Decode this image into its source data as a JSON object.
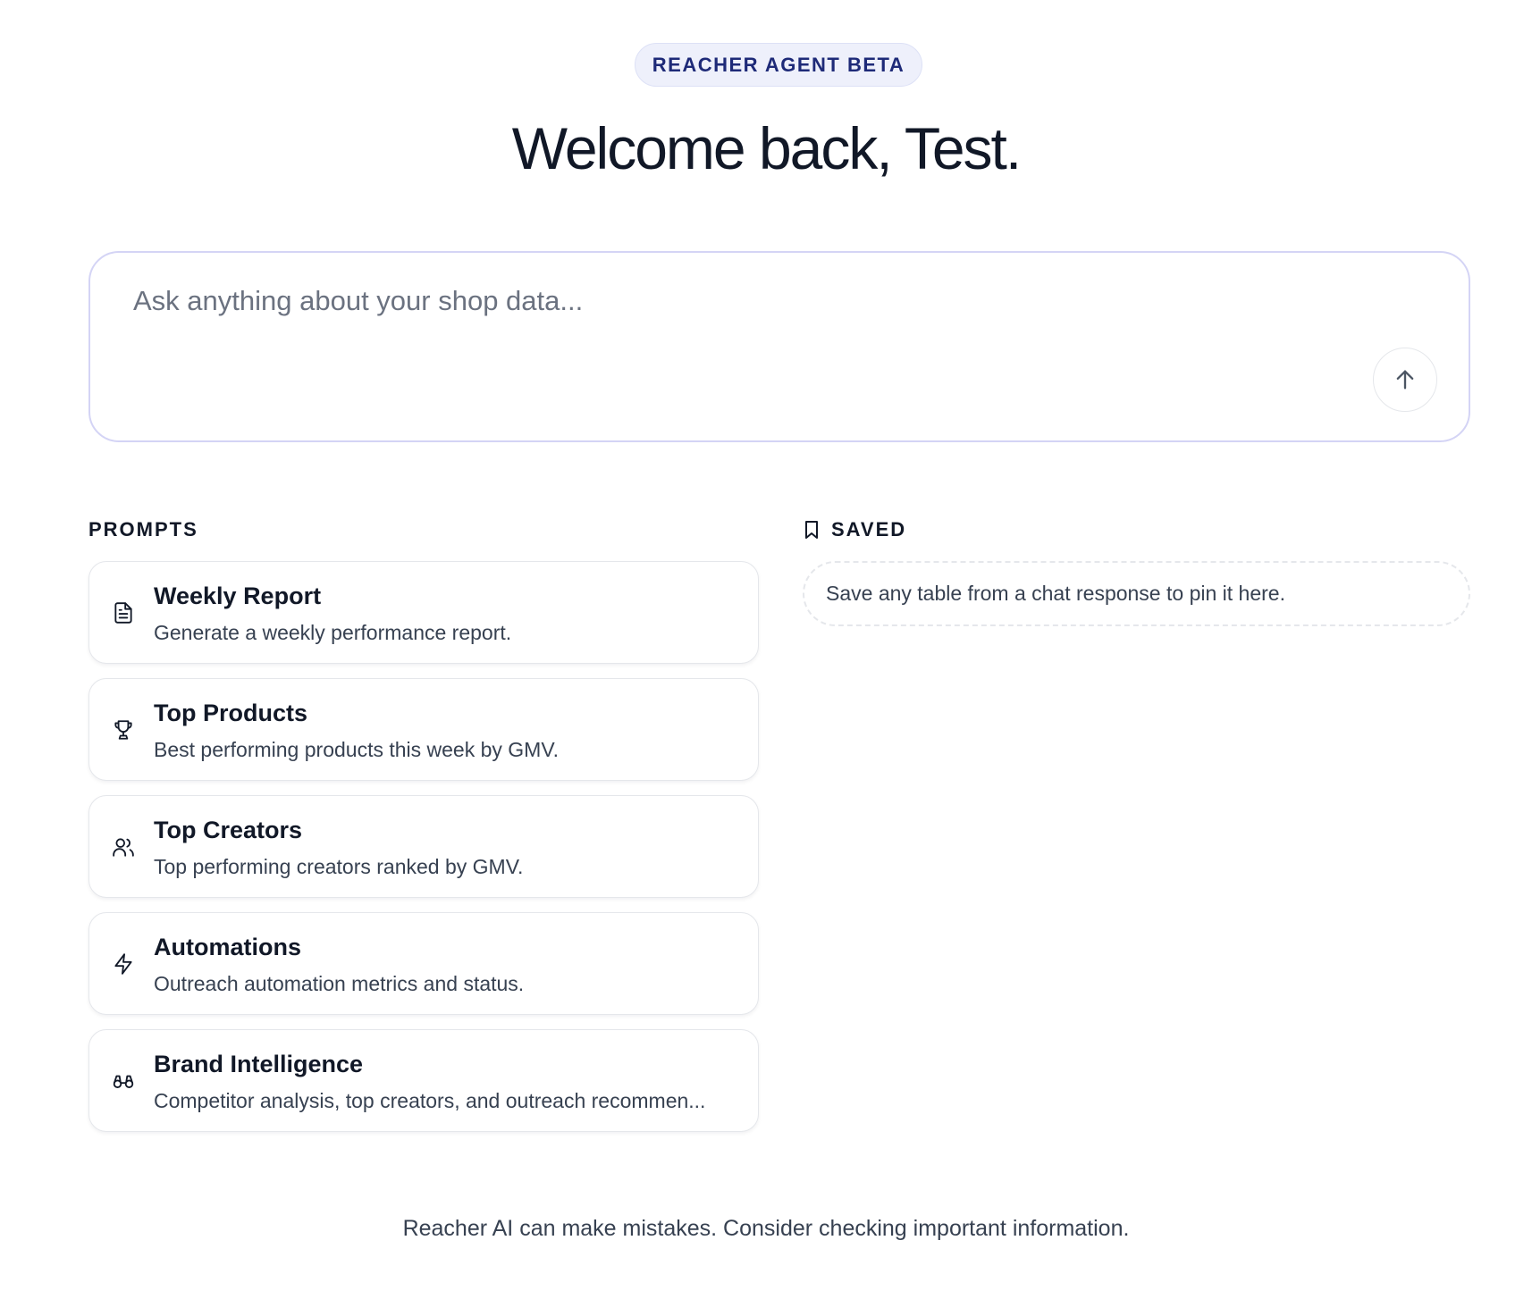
{
  "header": {
    "badge": "REACHER AGENT BETA",
    "title": "Welcome back, Test."
  },
  "composer": {
    "placeholder": "Ask anything about your shop data...",
    "send_icon": "arrow-up-icon"
  },
  "prompts": {
    "heading": "PROMPTS",
    "items": [
      {
        "title": "Weekly Report",
        "description": "Generate a weekly performance report.",
        "icon": "document-icon"
      },
      {
        "title": "Top Products",
        "description": "Best performing products this week by GMV.",
        "icon": "trophy-icon"
      },
      {
        "title": "Top Creators",
        "description": "Top performing creators ranked by GMV.",
        "icon": "users-icon"
      },
      {
        "title": "Automations",
        "description": "Outreach automation metrics and status.",
        "icon": "lightning-icon"
      },
      {
        "title": "Brand Intelligence",
        "description": "Competitor analysis, top creators, and outreach recommen...",
        "icon": "binoculars-icon"
      }
    ]
  },
  "saved": {
    "heading": "SAVED",
    "icon": "bookmark-icon",
    "empty_text": "Save any table from a chat response to pin it here."
  },
  "footer": {
    "disclaimer": "Reacher AI can make mistakes. Consider checking important information."
  },
  "colors": {
    "badge_bg": "#eef0fb",
    "badge_text": "#1e2a78",
    "composer_border": "#d4d4f5",
    "text_primary": "#111827",
    "text_secondary": "#374151",
    "placeholder": "#6b7280"
  }
}
